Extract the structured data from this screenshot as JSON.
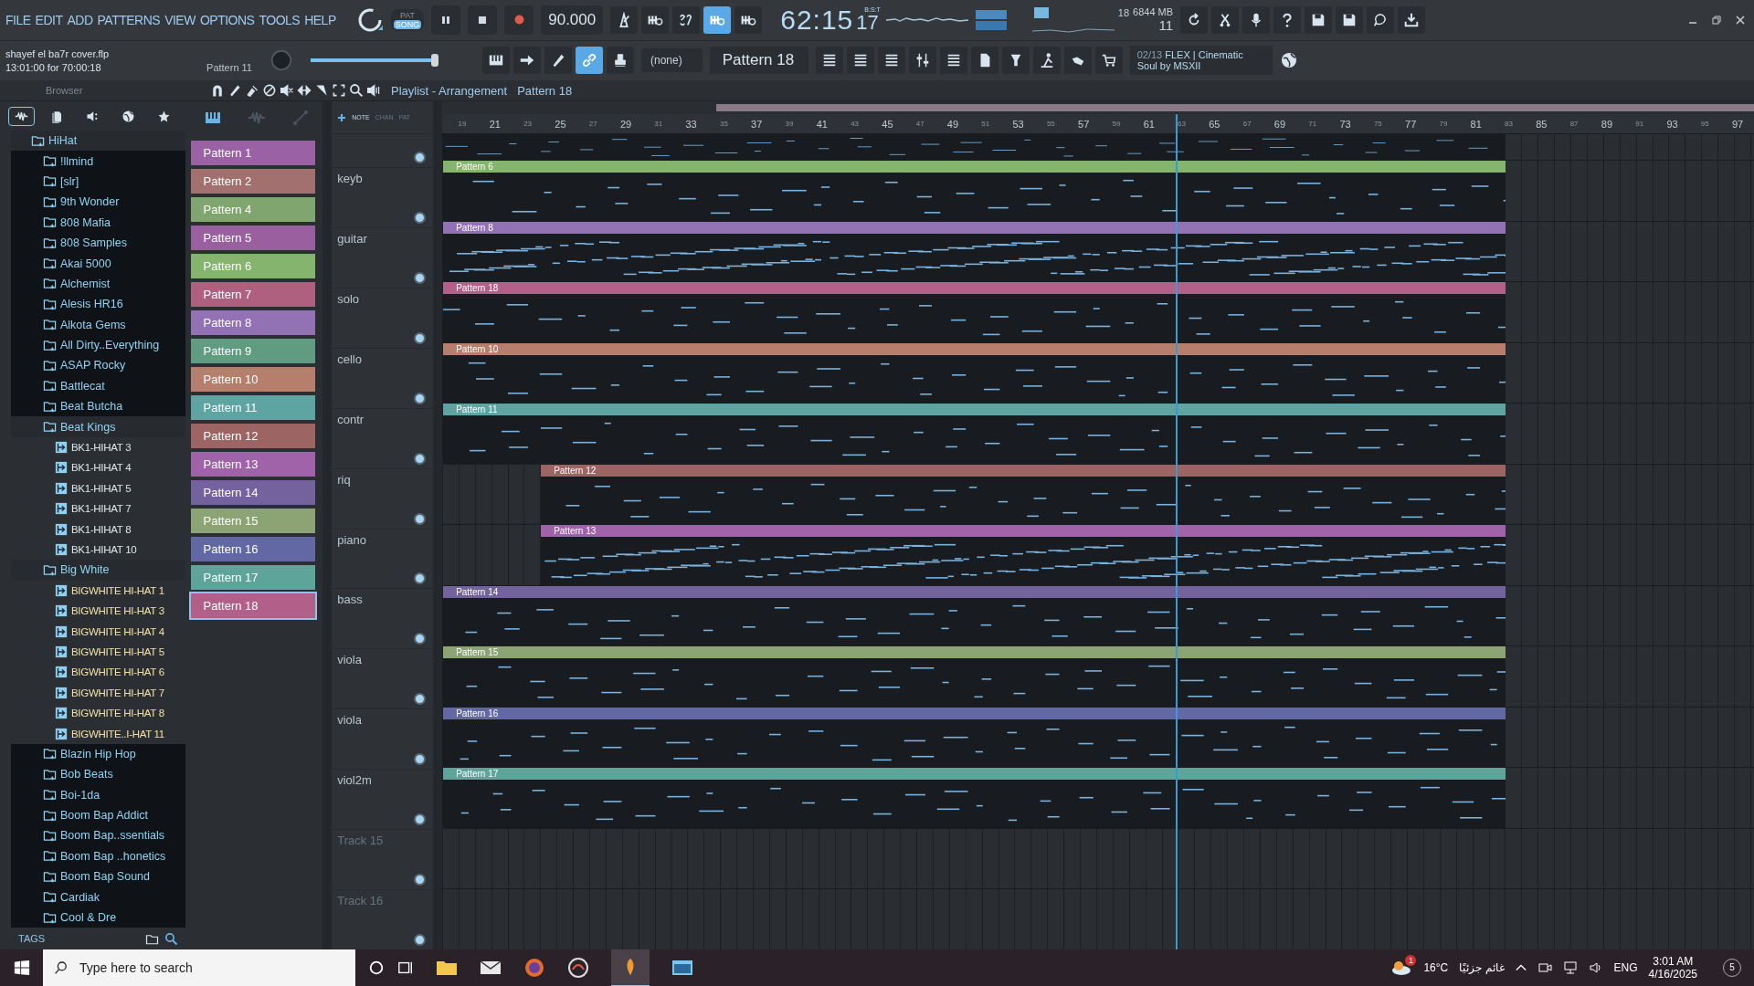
{
  "menu": [
    "FILE",
    "EDIT",
    "ADD",
    "PATTERNS",
    "VIEW",
    "OPTIONS",
    "TOOLS",
    "HELP"
  ],
  "transport": {
    "modes": [
      {
        "label": "PAT",
        "selected": false
      },
      {
        "label": "SONG",
        "selected": true
      }
    ],
    "tempo": "90.000",
    "time": "62:15",
    "time_ticks": "17",
    "time_format": "B:S:T"
  },
  "monitor": {
    "cpu": "18",
    "memory": "6844 MB",
    "polyphony": "11"
  },
  "project": {
    "file": "shayef el ba7r cover.flp",
    "duration": "13:01:00 for 70:00:18",
    "pattern": "Pattern 11"
  },
  "snap": "(none)",
  "master_slider": {
    "level": 0.8
  },
  "pattern_selector": "Pattern 18",
  "news": {
    "index": "02/13",
    "line_1": "FLEX | Cinematic",
    "line_2": "Soul by MSXII"
  },
  "browser": {
    "title": "Browser",
    "tabs": [
      {
        "kind": "all",
        "selected": true
      },
      {
        "kind": "files",
        "selected": false
      },
      {
        "kind": "plugins",
        "selected": false
      },
      {
        "kind": "online",
        "selected": false
      },
      {
        "kind": "favorites",
        "selected": false
      }
    ],
    "tags_label": "TAGS",
    "tree": [
      {
        "kind": "folder",
        "label": "HiHat",
        "expanded": true,
        "children": [
          {
            "kind": "folder",
            "label": "!llmind",
            "expanded": false
          },
          {
            "kind": "folder",
            "label": "[slr]",
            "expanded": false
          },
          {
            "kind": "folder",
            "label": "9th Wonder",
            "expanded": false
          },
          {
            "kind": "folder",
            "label": "808 Mafia",
            "expanded": false
          },
          {
            "kind": "folder",
            "label": "808 Samples",
            "expanded": false
          },
          {
            "kind": "folder",
            "label": "Akai 5000",
            "expanded": false
          },
          {
            "kind": "folder",
            "label": "Alchemist",
            "expanded": false
          },
          {
            "kind": "folder",
            "label": "Alesis HR16",
            "expanded": false
          },
          {
            "kind": "folder",
            "label": "Alkota Gems",
            "expanded": false
          },
          {
            "kind": "folder",
            "label": "All Dirty..Everything",
            "expanded": false
          },
          {
            "kind": "folder",
            "label": "ASAP Rocky",
            "expanded": false
          },
          {
            "kind": "folder",
            "label": "Battlecat",
            "expanded": false
          },
          {
            "kind": "folder",
            "label": "Beat Butcha",
            "expanded": false
          },
          {
            "kind": "folder",
            "label": "Beat Kings",
            "expanded": true,
            "children": [
              {
                "kind": "file",
                "label": "BK1-HIHAT 3",
                "highlighted": false
              },
              {
                "kind": "file",
                "label": "BK1-HIHAT 4",
                "highlighted": false
              },
              {
                "kind": "file",
                "label": "BK1-HIHAT 5",
                "highlighted": false
              },
              {
                "kind": "file",
                "label": "BK1-HIHAT 7",
                "highlighted": false
              },
              {
                "kind": "file",
                "label": "BK1-HIHAT 8",
                "highlighted": false
              },
              {
                "kind": "file",
                "label": "BK1-HIHAT 10",
                "highlighted": false
              }
            ]
          },
          {
            "kind": "folder",
            "label": "Big White",
            "expanded": true,
            "children": [
              {
                "kind": "file",
                "label": "BIGWHITE HI-HAT 1",
                "highlighted": true
              },
              {
                "kind": "file",
                "label": "BIGWHITE HI-HAT 3",
                "highlighted": true
              },
              {
                "kind": "file",
                "label": "BIGWHITE HI-HAT 4",
                "highlighted": true
              },
              {
                "kind": "file",
                "label": "BIGWHITE HI-HAT 5",
                "highlighted": true
              },
              {
                "kind": "file",
                "label": "BIGWHITE HI-HAT 6",
                "highlighted": true
              },
              {
                "kind": "file",
                "label": "BIGWHITE HI-HAT 7",
                "highlighted": true
              },
              {
                "kind": "file",
                "label": "BIGWHITE HI-HAT 8",
                "highlighted": true
              },
              {
                "kind": "file",
                "label": "BIGWHITE..I-HAT 11",
                "highlighted": true
              }
            ]
          },
          {
            "kind": "folder",
            "label": "Blazin Hip Hop",
            "expanded": false
          },
          {
            "kind": "folder",
            "label": "Bob Beats",
            "expanded": false
          },
          {
            "kind": "folder",
            "label": "Boi-1da",
            "expanded": false
          },
          {
            "kind": "folder",
            "label": "Boom Bap Addict",
            "expanded": false
          },
          {
            "kind": "folder",
            "label": "Boom Bap..ssentials",
            "expanded": false
          },
          {
            "kind": "folder",
            "label": "Boom Bap ..honetics",
            "expanded": false
          },
          {
            "kind": "folder",
            "label": "Boom Bap Sound",
            "expanded": false
          },
          {
            "kind": "folder",
            "label": "Cardiak",
            "expanded": false
          },
          {
            "kind": "folder",
            "label": "Cool & Dre",
            "expanded": false
          }
        ]
      }
    ]
  },
  "playlist": {
    "breadcrumb": [
      "Playlist - Arrangement",
      "Pattern 18"
    ],
    "picker_modes": [
      {
        "kind": "piano",
        "selected": true
      },
      {
        "kind": "wave",
        "selected": false
      },
      {
        "kind": "automation",
        "selected": false
      }
    ],
    "track_tabs": [
      {
        "label": "NOTE",
        "selected": true
      },
      {
        "label": "CHAN",
        "selected": false
      },
      {
        "label": "PAT",
        "selected": false
      }
    ],
    "patterns": [
      {
        "name": "Pattern 1",
        "color": "#9a62a4",
        "selected": false
      },
      {
        "name": "Pattern 2",
        "color": "#a2716f",
        "selected": false
      },
      {
        "name": "Pattern 4",
        "color": "#80a56e",
        "selected": false
      },
      {
        "name": "Pattern 5",
        "color": "#9a5f9f",
        "selected": false
      },
      {
        "name": "Pattern 6",
        "color": "#84b46e",
        "selected": false
      },
      {
        "name": "Pattern 7",
        "color": "#b0607f",
        "selected": false
      },
      {
        "name": "Pattern 8",
        "color": "#9272b4",
        "selected": false
      },
      {
        "name": "Pattern 9",
        "color": "#5f9c82",
        "selected": false
      },
      {
        "name": "Pattern 10",
        "color": "#b67e6c",
        "selected": false
      },
      {
        "name": "Pattern 11",
        "color": "#5ea4a2",
        "selected": false
      },
      {
        "name": "Pattern 12",
        "color": "#9c6462",
        "selected": false
      },
      {
        "name": "Pattern 13",
        "color": "#a062a8",
        "selected": false
      },
      {
        "name": "Pattern 14",
        "color": "#74629e",
        "selected": false
      },
      {
        "name": "Pattern 15",
        "color": "#8ca474",
        "selected": false
      },
      {
        "name": "Pattern 16",
        "color": "#6268a4",
        "selected": false
      },
      {
        "name": "Pattern 17",
        "color": "#5fa49a",
        "selected": false
      },
      {
        "name": "Pattern 18",
        "color": "#b2608a",
        "selected": true
      }
    ],
    "ruler": [
      "19",
      "21",
      "23",
      "25",
      "27",
      "29",
      "31",
      "33",
      "35",
      "37",
      "39",
      "41",
      "43",
      "45",
      "47",
      "49",
      "51",
      "53",
      "55",
      "57",
      "59",
      "61",
      "63",
      "65",
      "67",
      "69",
      "71",
      "73",
      "75",
      "77",
      "79",
      "81",
      "83",
      "85",
      "87",
      "89",
      "91",
      "93",
      "95",
      "97"
    ],
    "tracks": [
      {
        "name": "keyb",
        "clip": {
          "label": "Pattern 6",
          "color": "#84b46e",
          "kind": "full"
        }
      },
      {
        "name": "guitar",
        "clip": {
          "label": "Pattern 8",
          "color": "#9272b4",
          "kind": "full"
        }
      },
      {
        "name": "solo",
        "clip": {
          "label": "Pattern 18",
          "color": "#b2608a",
          "kind": "full"
        }
      },
      {
        "name": "cello",
        "clip": {
          "label": "Pattern 10",
          "color": "#b67e6c",
          "kind": "full"
        }
      },
      {
        "name": "contr",
        "clip": {
          "label": "Pattern 11",
          "color": "#5ea4a2",
          "kind": "full"
        }
      },
      {
        "name": "riq",
        "clip": {
          "label": "Pattern 12",
          "color": "#9c6462",
          "kind": "late"
        }
      },
      {
        "name": "piano",
        "clip": {
          "label": "Pattern 13",
          "color": "#a062a8",
          "kind": "late"
        }
      },
      {
        "name": "bass",
        "clip": {
          "label": "Pattern 14",
          "color": "#74629e",
          "kind": "full"
        }
      },
      {
        "name": "viola",
        "clip": {
          "label": "Pattern 15",
          "color": "#8ca474",
          "kind": "full"
        }
      },
      {
        "name": "viola",
        "clip": {
          "label": "Pattern 16",
          "color": "#6268a4",
          "kind": "full"
        }
      },
      {
        "name": "viol2m",
        "clip": {
          "label": "Pattern 17",
          "color": "#5fa49a",
          "kind": "full"
        }
      },
      {
        "name": "Track 15"
      },
      {
        "name": "Track 16"
      }
    ]
  },
  "taskbar": {
    "search_placeholder": "Type here to search",
    "temperature": "16°C",
    "weather": "غائم جزئيًا",
    "weather_badge": "1",
    "language": "ENG",
    "time": "3:01 AM",
    "date": "4/16/2025",
    "notifications": "5"
  }
}
